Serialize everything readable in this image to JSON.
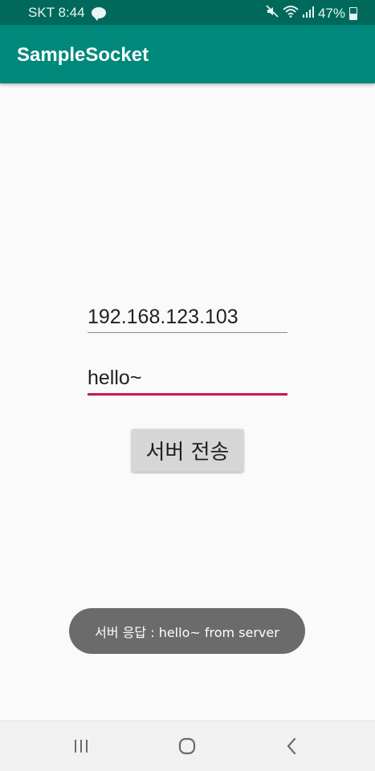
{
  "status_bar": {
    "carrier_time": "SKT 8:44",
    "notification_icon": "kakaotalk-icon",
    "battery_percent": "47%",
    "battery_level": 0.47
  },
  "app_bar": {
    "title": "SampleSocket"
  },
  "form": {
    "ip_value": "192.168.123.103",
    "message_value": "hello~",
    "send_button_label": "서버 전송"
  },
  "toast": {
    "text": "서버 응답 : hello~ from server"
  },
  "nav_bar": {
    "recents_icon": "recents-icon",
    "home_icon": "home-icon",
    "back_icon": "back-icon"
  },
  "colors": {
    "status_bar": "#00695c",
    "app_bar": "#00897b",
    "accent": "#c2185b",
    "toast_bg": "#6b6b6b"
  }
}
